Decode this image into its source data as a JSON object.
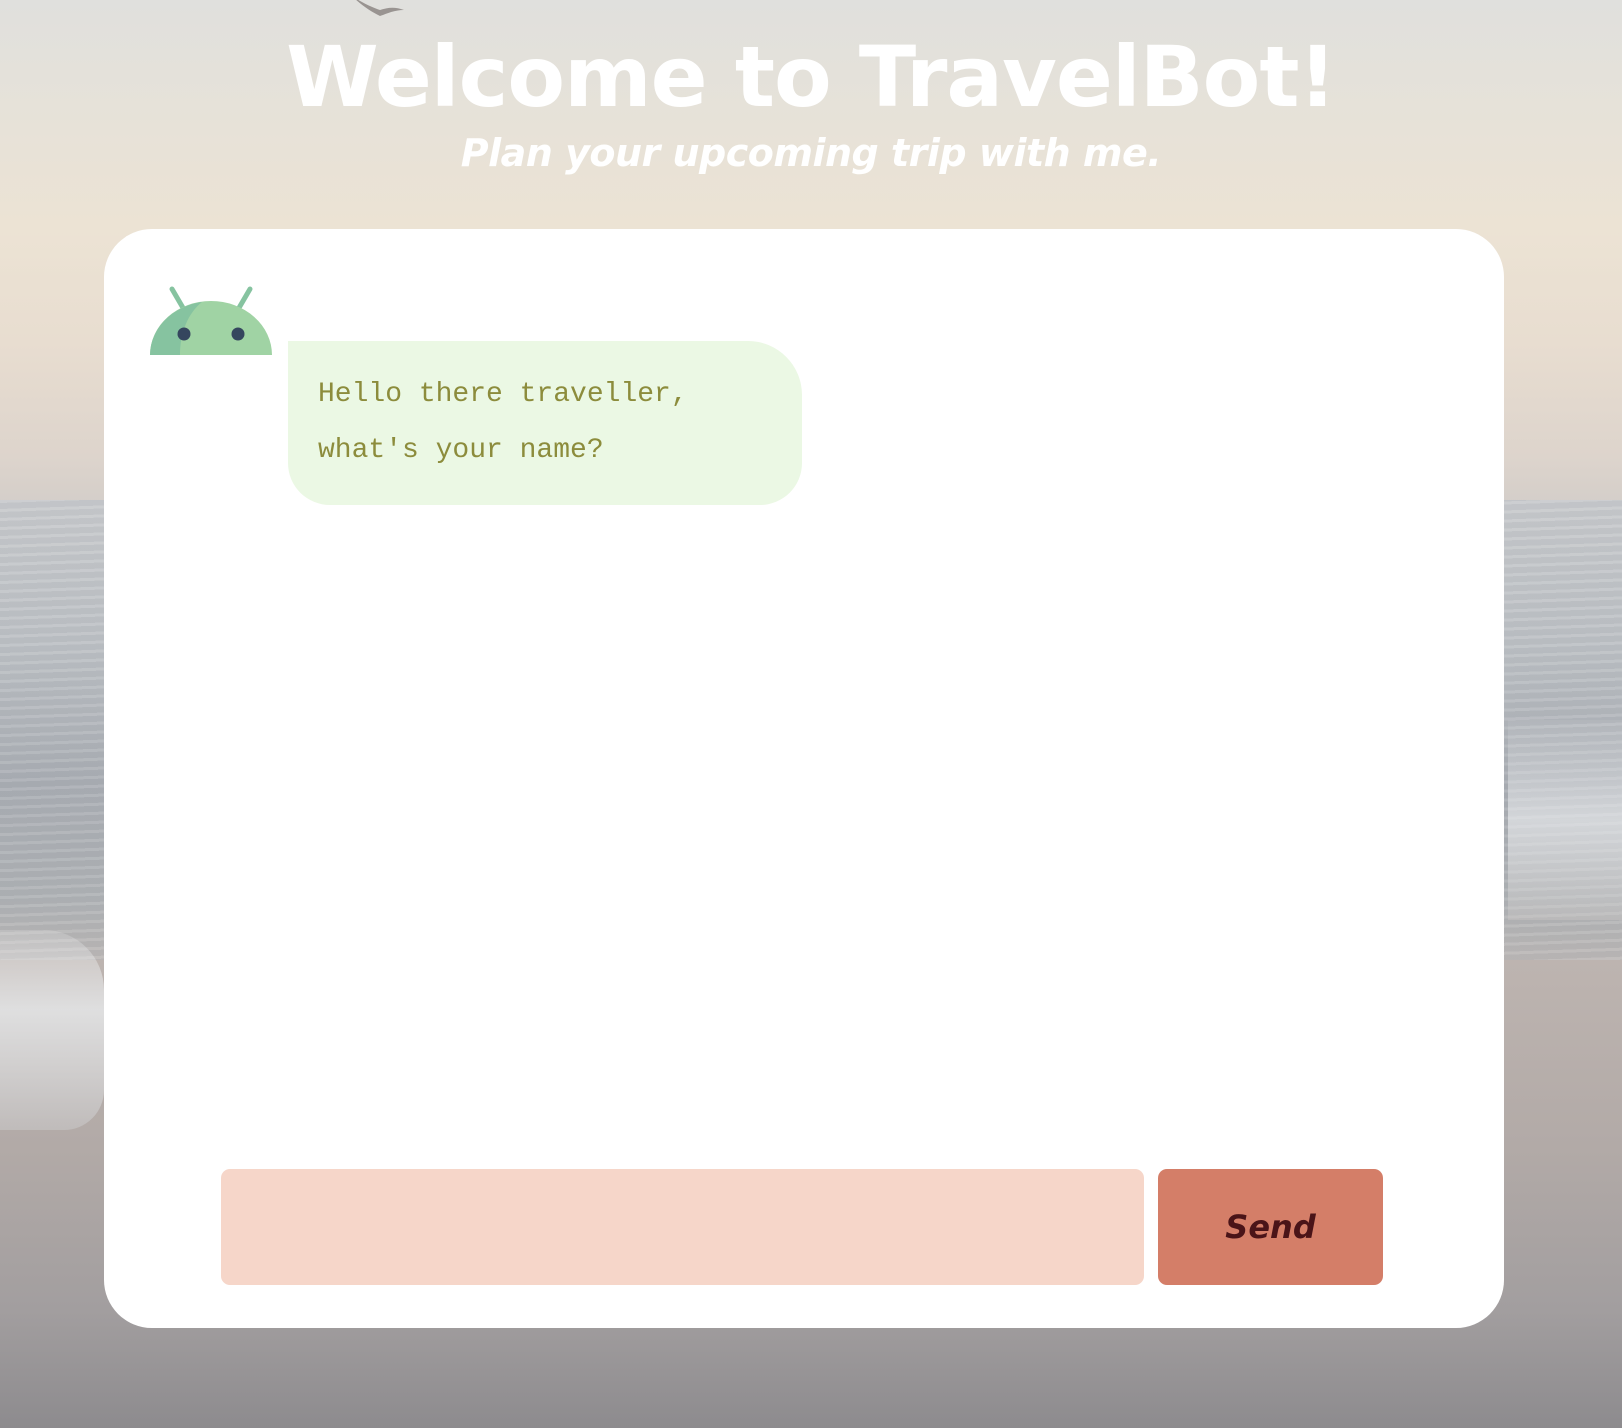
{
  "header": {
    "title": "Welcome to TravelBot!",
    "subtitle": "Plan your upcoming trip with me."
  },
  "chat": {
    "bot_icon": "android-robot-icon",
    "messages": [
      {
        "sender": "bot",
        "text": "Hello there traveller,\nwhat's your name?"
      }
    ]
  },
  "composer": {
    "input_value": "",
    "input_placeholder": "",
    "send_label": "Send"
  },
  "colors": {
    "bubble_bg": "#ebf8e4",
    "bubble_text": "#8c8c3c",
    "input_bg": "#f6d6c9",
    "send_bg": "#d47e68",
    "send_text": "#4a1418",
    "bot_green": "#a0d3a4",
    "bot_green_dark": "#86c3a0"
  }
}
